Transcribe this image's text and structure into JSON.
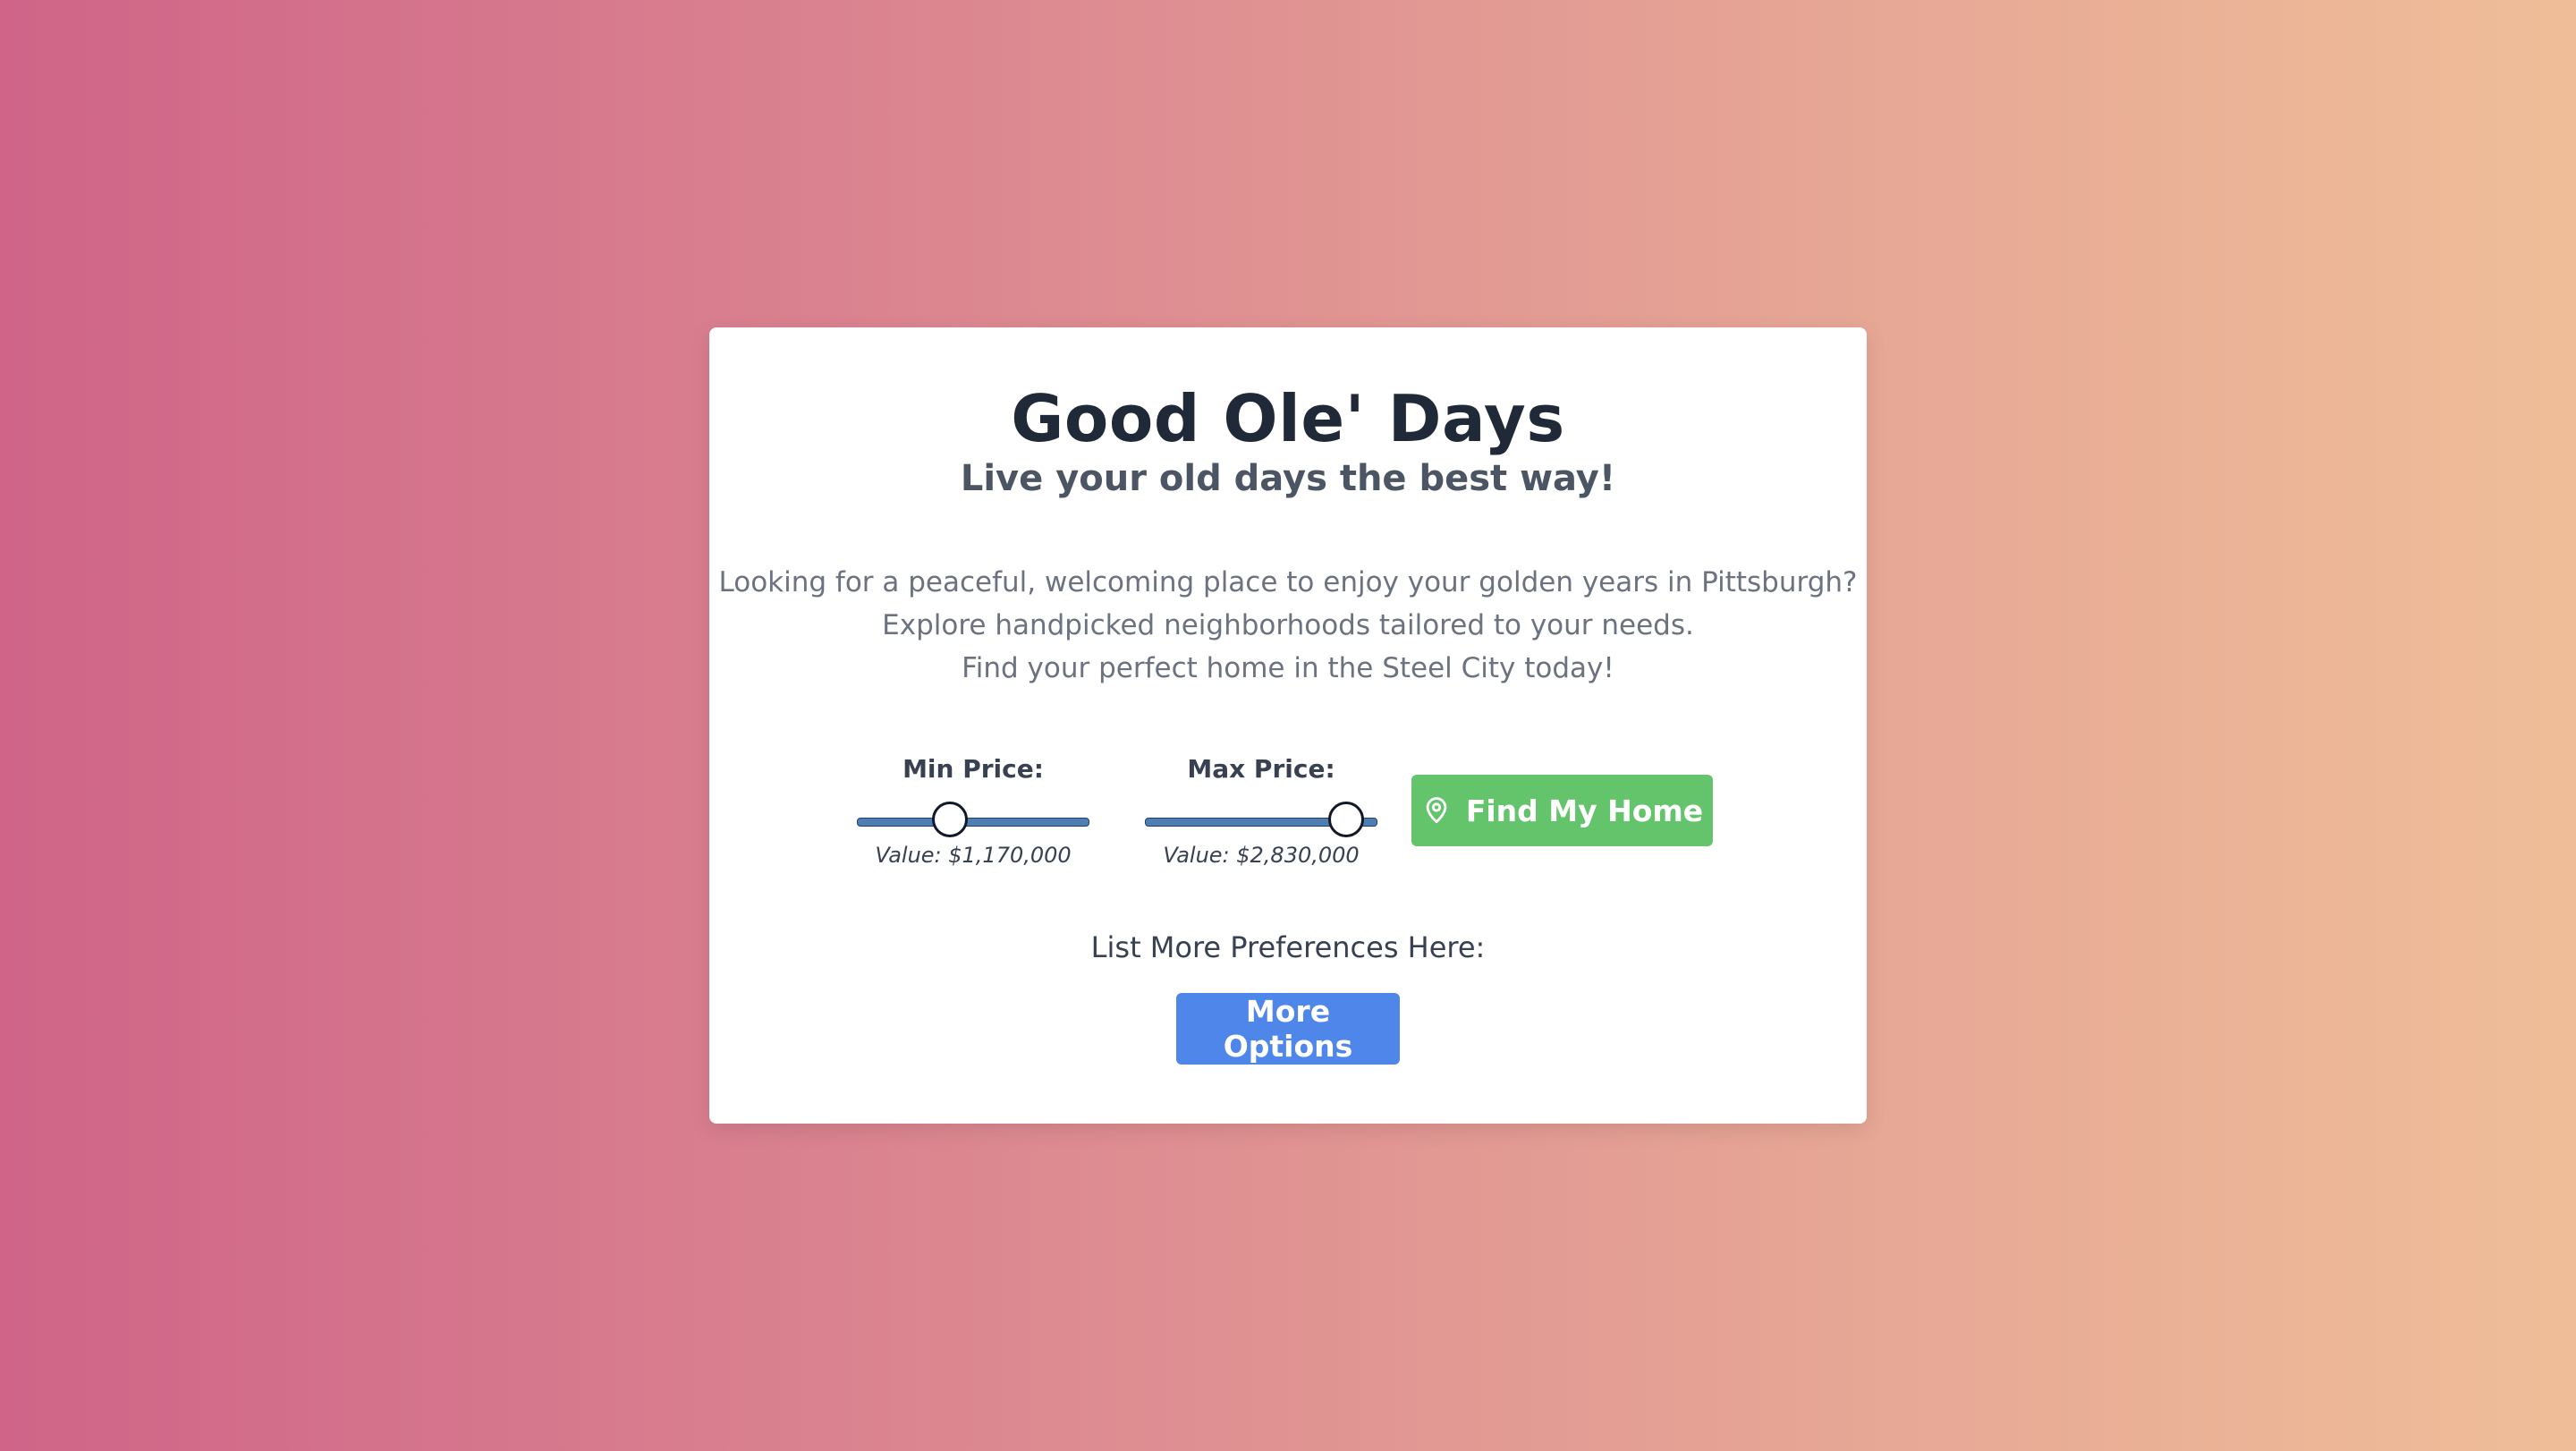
{
  "card": {
    "title": "Good Ole' Days",
    "subtitle": "Live your old days the best way!",
    "description": [
      "Looking for a peaceful, welcoming place to enjoy your golden years in Pittsburgh?",
      "Explore handpicked neighborhoods tailored to your needs.",
      "Find your perfect home in the Steel City today!"
    ]
  },
  "filters": {
    "min_price": {
      "label": "Min Price:",
      "value_text": "Value: $1,170,000",
      "fill_fraction": 0.4
    },
    "max_price": {
      "label": "Max Price:",
      "value_text": "Value: $2,830,000",
      "fill_fraction": 0.87
    }
  },
  "actions": {
    "find_label": "Find My Home",
    "find_icon": "map-pin-icon",
    "prefs_label": "List More Preferences Here:",
    "more_label": "More Options"
  },
  "colors": {
    "find_button": "#63c46b",
    "more_button": "#4f86ea",
    "slider_track": "#4f7fb2"
  }
}
